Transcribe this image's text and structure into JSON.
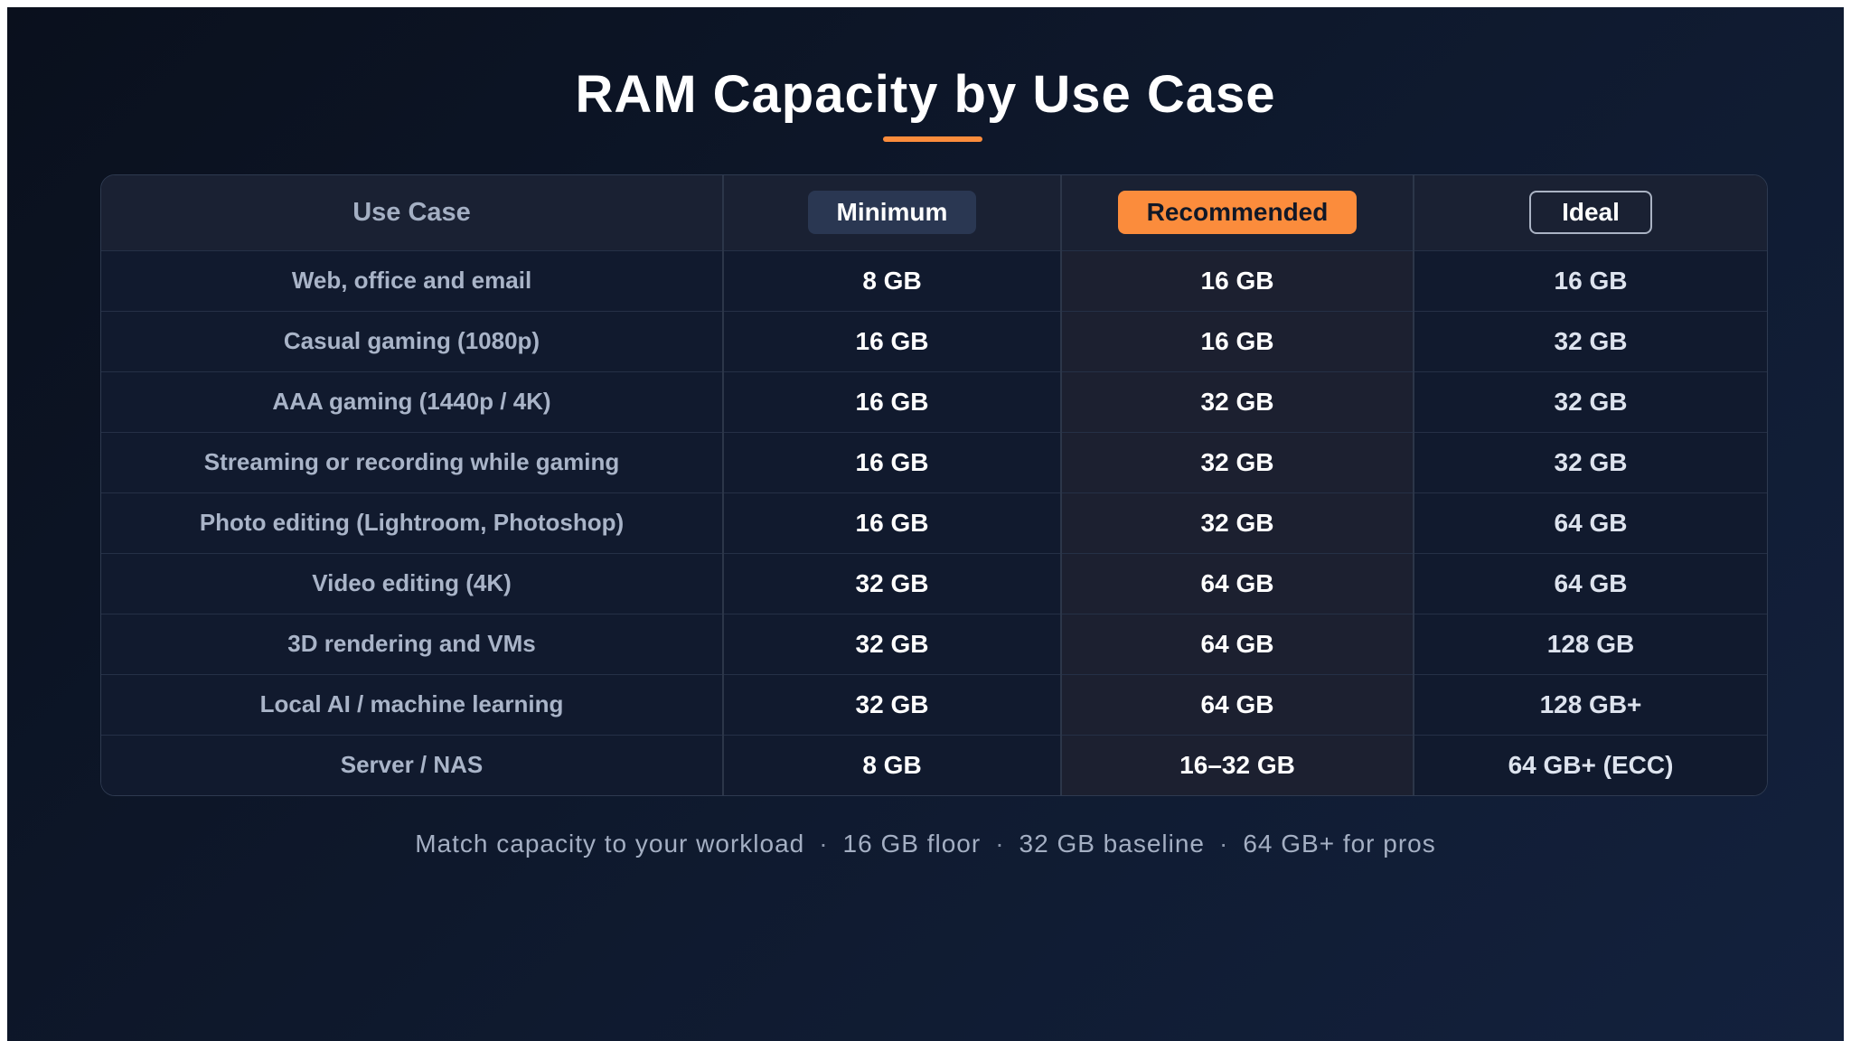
{
  "title": "RAM Capacity by Use Case",
  "colors": {
    "accent": "#fb8c3c",
    "background": "#0f172b",
    "minimum_pill": "#2a3752"
  },
  "table": {
    "headers": {
      "use_case": "Use Case",
      "minimum": "Minimum",
      "recommended": "Recommended",
      "ideal": "Ideal"
    },
    "rows": [
      {
        "use_case": "Web, office and email",
        "minimum": "8 GB",
        "recommended": "16 GB",
        "ideal": "16 GB"
      },
      {
        "use_case": "Casual gaming (1080p)",
        "minimum": "16 GB",
        "recommended": "16 GB",
        "ideal": "32 GB"
      },
      {
        "use_case": "AAA gaming (1440p / 4K)",
        "minimum": "16 GB",
        "recommended": "32 GB",
        "ideal": "32 GB"
      },
      {
        "use_case": "Streaming or recording while gaming",
        "minimum": "16 GB",
        "recommended": "32 GB",
        "ideal": "32 GB"
      },
      {
        "use_case": "Photo editing (Lightroom, Photoshop)",
        "minimum": "16 GB",
        "recommended": "32 GB",
        "ideal": "64 GB"
      },
      {
        "use_case": "Video editing (4K)",
        "minimum": "32 GB",
        "recommended": "64 GB",
        "ideal": "64 GB"
      },
      {
        "use_case": "3D rendering and VMs",
        "minimum": "32 GB",
        "recommended": "64 GB",
        "ideal": "128 GB"
      },
      {
        "use_case": "Local AI / machine learning",
        "minimum": "32 GB",
        "recommended": "64 GB",
        "ideal": "128 GB+"
      },
      {
        "use_case": "Server / NAS",
        "minimum": "8 GB",
        "recommended": "16–32 GB",
        "ideal": "64 GB+ (ECC)"
      }
    ]
  },
  "footer": {
    "items": [
      "Match capacity to your workload",
      "16 GB floor",
      "32 GB baseline",
      "64 GB+ for pros"
    ],
    "separator": "·"
  }
}
